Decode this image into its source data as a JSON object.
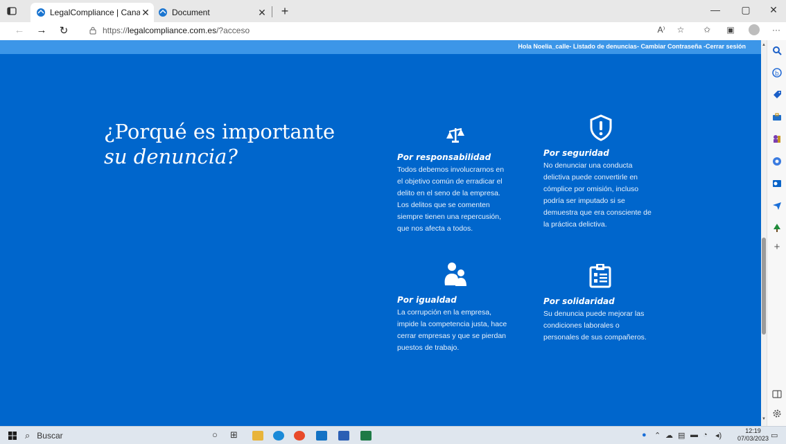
{
  "browser": {
    "tabs": [
      {
        "label": "LegalCompliance | Canal ético pa",
        "active": true
      },
      {
        "label": "Document",
        "active": false
      }
    ],
    "new_tab": "+",
    "url_prefix": "https://",
    "url_domain": "legalcompliance.com.es",
    "url_path": "/?acceso",
    "minimize": "—",
    "restore": "▢",
    "close": "✕",
    "read_aloud": "A⁾",
    "more": "···"
  },
  "page": {
    "top_links": "Hola Noelia_calle- Listado de denuncias- Cambiar Contraseña -Cerrar sesión",
    "headline_line1": "¿Porqué es importante",
    "headline_line2": "su denuncia?",
    "features": [
      {
        "icon": "scales-icon",
        "title": "Por responsabilidad",
        "lines": [
          "Todos debemos involucrarnos en",
          "el objetivo común de erradicar el",
          "delito en el seno de la empresa.",
          "Los delitos que se comenten",
          "siempre tienen una repercusión,",
          "que nos afecta a todos."
        ]
      },
      {
        "icon": "shield-alert-icon",
        "title": "Por seguridad",
        "lines": [
          "No denunciar una conducta",
          "delictiva puede convertirle en",
          "cómplice por omisión, incluso",
          "podría ser imputado si se",
          "demuestra que era consciente de",
          "la práctica delictiva."
        ]
      },
      {
        "icon": "people-icon",
        "title": "Por igualdad",
        "lines": [
          "La corrupción en la empresa,",
          "impide la competencia justa, hace",
          "cerrar empresas y que se pierdan",
          "puestos de trabajo."
        ]
      },
      {
        "icon": "clipboard-list-icon",
        "title": "Por solidaridad",
        "lines": [
          "Su denuncia puede mejorar las",
          "condiciones laborales o",
          "personales de sus compañeros."
        ]
      }
    ]
  },
  "taskbar": {
    "search_label": "Buscar",
    "time": "12:19",
    "date": "07/03/2023"
  },
  "colors": {
    "page_bg": "#0066cc",
    "top_strip": "#3c96e8"
  }
}
